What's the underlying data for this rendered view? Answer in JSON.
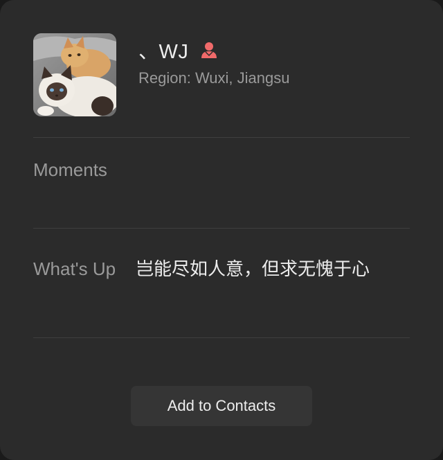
{
  "profile": {
    "name": "、WJ",
    "gender_icon": "female-icon",
    "gender_color": "#f06a6a",
    "region": "Region: Wuxi, Jiangsu"
  },
  "fields": {
    "moments_label": "Moments",
    "whats_up_label": "What's Up",
    "whats_up_value": "岂能尽如人意，但求无愧于心"
  },
  "actions": {
    "add_contact_label": "Add to Contacts"
  }
}
